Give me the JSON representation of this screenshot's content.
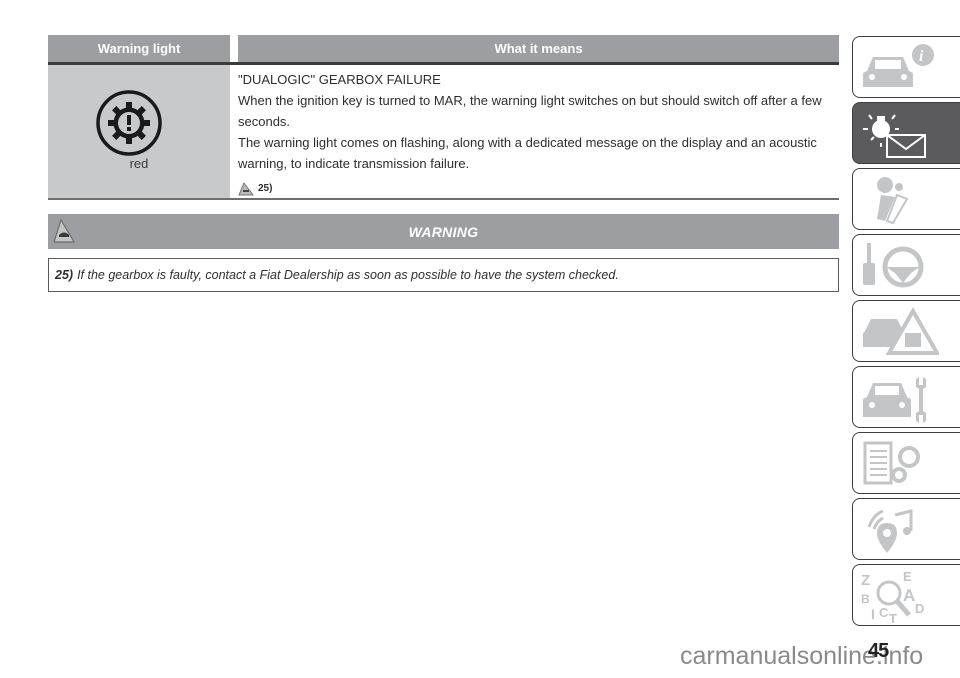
{
  "table": {
    "headers": {
      "col1": "Warning light",
      "col2": "What it means"
    },
    "rows": [
      {
        "icon": "dualogic-gearbox-failure-icon",
        "color_label": "red",
        "title": "\"DUALOGIC\" GEARBOX FAILURE",
        "lines": [
          "When the ignition key is turned to MAR, the warning light switches on but should switch off after a few",
          "seconds.",
          "The warning light comes on flashing, along with a dedicated message on the display and an acoustic",
          "warning, to indicate transmission failure."
        ],
        "reference": "25)"
      }
    ]
  },
  "warning": {
    "title": "WARNING",
    "notes": [
      {
        "number": "25)",
        "text": "If the gearbox is faulty, contact a Fiat Dealership as soon as possible to have the system checked."
      }
    ]
  },
  "sidebar": {
    "tabs": [
      {
        "name": "knowing-your-car",
        "icon": "car-info-icon",
        "active": false
      },
      {
        "name": "knowing-instrument-panel",
        "icon": "warning-light-message-icon",
        "active": true
      },
      {
        "name": "safety",
        "icon": "airbag-seat-icon",
        "active": false
      },
      {
        "name": "starting-and-driving",
        "icon": "key-steering-wheel-icon",
        "active": false
      },
      {
        "name": "in-an-emergency",
        "icon": "car-emergency-triangle-icon",
        "active": false
      },
      {
        "name": "servicing-and-care",
        "icon": "car-wrench-icon",
        "active": false
      },
      {
        "name": "technical-data",
        "icon": "list-gears-icon",
        "active": false
      },
      {
        "name": "multimedia",
        "icon": "radio-music-nav-icon",
        "active": false
      },
      {
        "name": "index",
        "icon": "alphabet-search-icon",
        "active": false
      }
    ]
  },
  "page_number": "45",
  "watermark": "carmanualsonline.info",
  "colors": {
    "header_gray": "#9d9ea1",
    "cell_gray": "#c8c9cb",
    "active_tab": "#5b5b5d",
    "icon_gray": "#c4c5c7"
  }
}
